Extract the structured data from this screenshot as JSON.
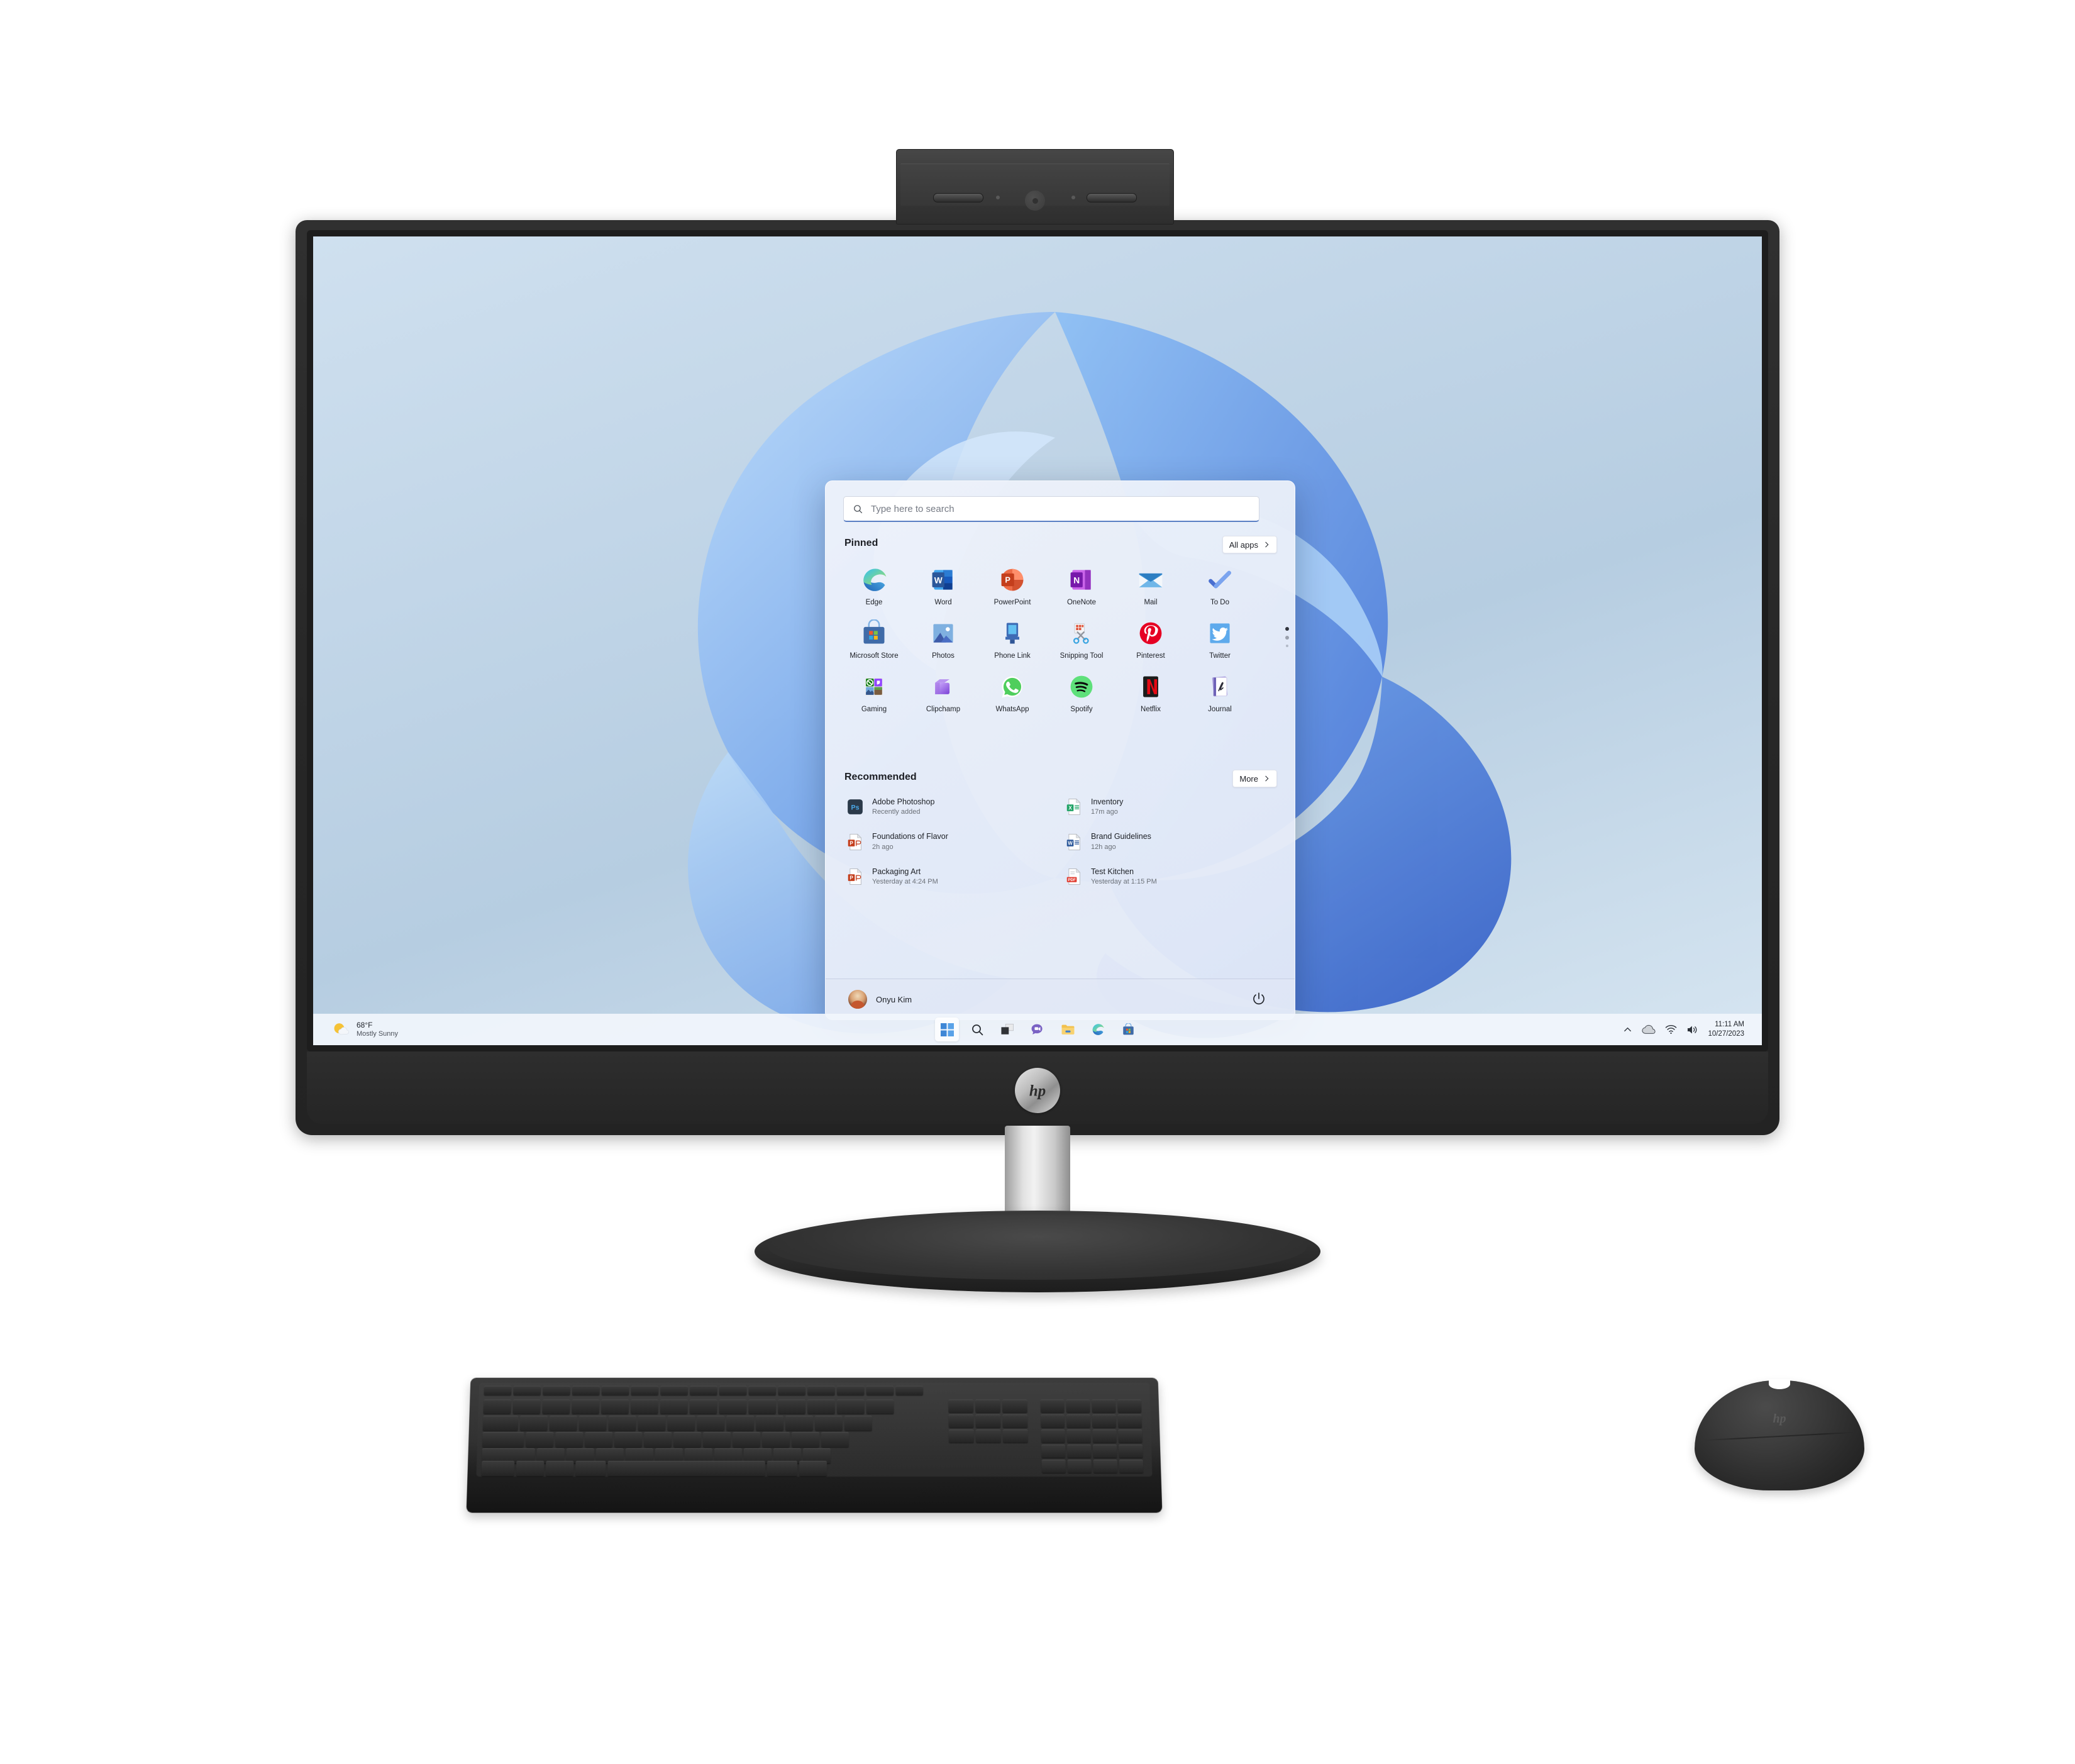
{
  "device": {
    "brand": "hp",
    "logo_text": "hp",
    "components": {
      "webcam": "pop-up-webcam",
      "stand": "column-stand",
      "base": "oval-fabric-base",
      "keyboard": "wireless-keyboard",
      "mouse": "wireless-mouse"
    }
  },
  "desktop": {
    "wallpaper": "windows-11-bloom"
  },
  "start_menu": {
    "search": {
      "placeholder": "Type here to search",
      "icon": "search-icon",
      "value": ""
    },
    "pinned": {
      "heading": "Pinned",
      "all_apps_label": "All apps",
      "apps": [
        {
          "label": "Edge",
          "icon": "edge-icon"
        },
        {
          "label": "Word",
          "icon": "word-icon"
        },
        {
          "label": "PowerPoint",
          "icon": "powerpoint-icon"
        },
        {
          "label": "OneNote",
          "icon": "onenote-icon"
        },
        {
          "label": "Mail",
          "icon": "mail-icon"
        },
        {
          "label": "To Do",
          "icon": "todo-icon"
        },
        {
          "label": "Microsoft Store",
          "icon": "microsoft-store-icon"
        },
        {
          "label": "Photos",
          "icon": "photos-icon"
        },
        {
          "label": "Phone Link",
          "icon": "phone-link-icon"
        },
        {
          "label": "Snipping Tool",
          "icon": "snipping-tool-icon"
        },
        {
          "label": "Pinterest",
          "icon": "pinterest-icon"
        },
        {
          "label": "Twitter",
          "icon": "twitter-icon"
        },
        {
          "label": "Gaming",
          "icon": "gaming-folder-icon"
        },
        {
          "label": "Clipchamp",
          "icon": "clipchamp-icon"
        },
        {
          "label": "WhatsApp",
          "icon": "whatsapp-icon"
        },
        {
          "label": "Spotify",
          "icon": "spotify-icon"
        },
        {
          "label": "Netflix",
          "icon": "netflix-icon"
        },
        {
          "label": "Journal",
          "icon": "journal-icon"
        }
      ],
      "page_indicator": {
        "pages": 3,
        "current": 1
      }
    },
    "recommended": {
      "heading": "Recommended",
      "more_label": "More",
      "items": [
        {
          "title": "Adobe Photoshop",
          "subtitle": "Recently added",
          "icon": "photoshop-icon"
        },
        {
          "title": "Inventory",
          "subtitle": "17m ago",
          "icon": "excel-file-icon"
        },
        {
          "title": "Foundations of Flavor",
          "subtitle": "2h ago",
          "icon": "powerpoint-file-icon"
        },
        {
          "title": "Brand Guidelines",
          "subtitle": "12h ago",
          "icon": "word-file-icon"
        },
        {
          "title": "Packaging Art",
          "subtitle": "Yesterday at 4:24 PM",
          "icon": "powerpoint-file-icon"
        },
        {
          "title": "Test Kitchen",
          "subtitle": "Yesterday at 1:15 PM",
          "icon": "pdf-file-icon"
        }
      ]
    },
    "footer": {
      "user_name": "Onyu Kim",
      "avatar": "user-avatar",
      "power_icon": "power-icon"
    }
  },
  "taskbar": {
    "weather": {
      "temperature": "68°F",
      "condition": "Mostly Sunny",
      "icon": "sun-cloud-icon"
    },
    "items": [
      {
        "name": "start",
        "icon": "windows-logo-icon",
        "active": true
      },
      {
        "name": "search",
        "icon": "search-icon",
        "active": false
      },
      {
        "name": "task-view",
        "icon": "task-view-icon",
        "active": false
      },
      {
        "name": "chat",
        "icon": "chat-icon",
        "active": false
      },
      {
        "name": "file-explorer",
        "icon": "folder-icon",
        "active": false
      },
      {
        "name": "edge",
        "icon": "edge-icon",
        "active": false
      },
      {
        "name": "microsoft-store",
        "icon": "store-icon",
        "active": false
      }
    ],
    "tray": {
      "chevron_icon": "chevron-up-icon",
      "onedrive_icon": "cloud-icon",
      "wifi_icon": "wifi-icon",
      "volume_icon": "speaker-icon",
      "time": "11:11 AM",
      "date": "10/27/2023"
    }
  },
  "colors": {
    "accent": "#5a7fc4",
    "taskbar_bg": "#f1f5fc",
    "menu_bg": "#eef2fa",
    "chassis": "#2e2e2e"
  }
}
